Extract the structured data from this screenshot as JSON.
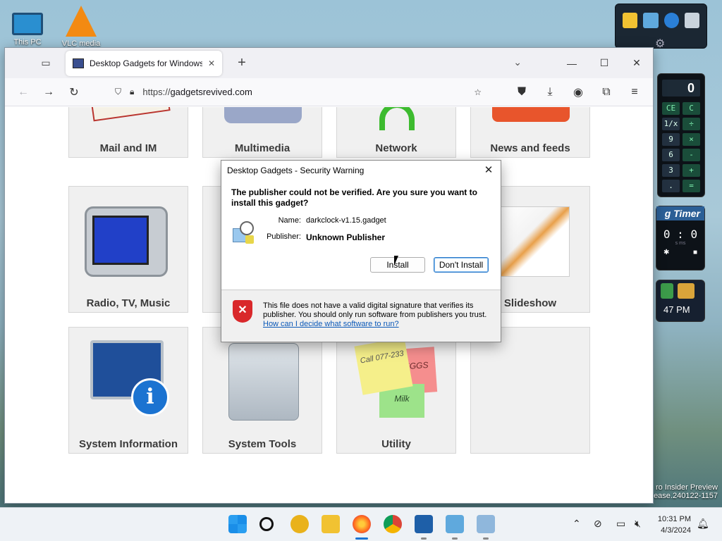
{
  "desktop": {
    "icons": [
      {
        "label": "This PC"
      },
      {
        "label": "VLC media"
      }
    ],
    "watermark_line1": "ro Insider Preview",
    "watermark_line2": "ease.240122-1157"
  },
  "gadgets": {
    "calculator": {
      "display": "0",
      "keys": [
        "CE",
        "C",
        "1/x",
        "÷",
        "9",
        "×",
        "6",
        "-",
        "3",
        "+",
        ".",
        "="
      ]
    },
    "timer": {
      "title": "g Timer",
      "value": "0 : 0",
      "units": "s        ms"
    },
    "clock": {
      "time": "47 PM"
    }
  },
  "browser": {
    "tab_title": "Desktop Gadgets for Windows",
    "url_scheme": "https://",
    "url_domain": "gadgetsrevived.com",
    "window_buttons": {
      "minimize": "—",
      "maximize": "☐",
      "close": "✕"
    }
  },
  "page": {
    "tiles": [
      {
        "label": "Mail and IM"
      },
      {
        "label": "Multimedia"
      },
      {
        "label": "Network"
      },
      {
        "label": "News and feeds"
      },
      {
        "label": "Radio, TV, Music"
      },
      {
        "label": "Slideshow"
      },
      {
        "label": "System Information"
      },
      {
        "label": "System Tools"
      },
      {
        "label": "Utility"
      }
    ],
    "sticky_notes": {
      "call": "Call 077-233",
      "eggs": "EGGS",
      "milk": "Milk"
    }
  },
  "dialog": {
    "title": "Desktop Gadgets - Security Warning",
    "question": "The publisher could not be verified. Are you sure you want to install this gadget?",
    "name_label": "Name:",
    "name_value": "darkclock-v1.15.gadget",
    "publisher_label": "Publisher:",
    "publisher_value": "Unknown Publisher",
    "install_button": "Install",
    "dont_install_button": "Don't Install",
    "footer_text": "This file does not have a valid digital signature that verifies its publisher. You should only run software from publishers you trust.",
    "footer_link": "How can I decide what software to run?"
  },
  "taskbar": {
    "time": "10:31 PM",
    "date": "4/3/2024",
    "apps": [
      "start",
      "search",
      "copilot-pre",
      "file-explorer",
      "firefox",
      "chrome",
      "task-manager",
      "gadgets",
      "remote-desktop"
    ]
  },
  "colors": {
    "accent": "#2a78c8",
    "link": "#0a58b8",
    "tile_bg": "#f0f0f0"
  }
}
